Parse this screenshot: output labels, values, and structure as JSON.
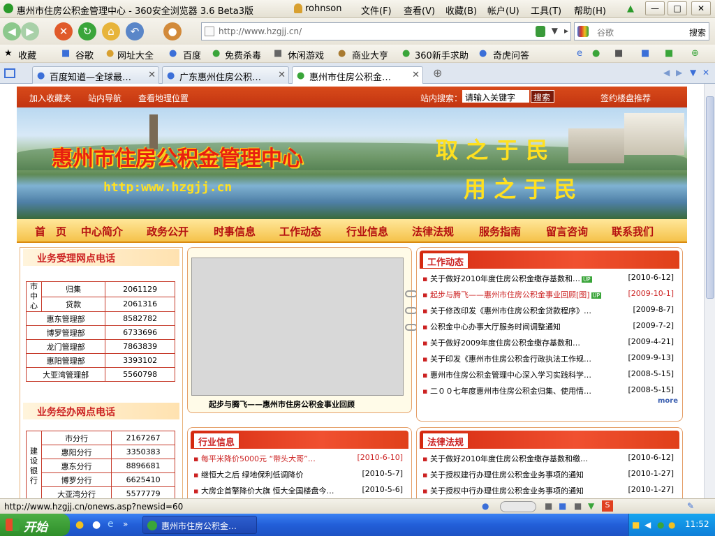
{
  "window": {
    "title": "惠州市住房公积金管理中心 - 360安全浏览器 3.6 Beta3版",
    "user": "rohnson",
    "menus": [
      "文件(F)",
      "查看(V)",
      "收藏(B)",
      "帐户(U)",
      "工具(T)",
      "帮助(H)"
    ]
  },
  "nav": {
    "url": "http://www.hzgjj.cn/",
    "search_placeholder": "谷歌",
    "search_button": "搜索"
  },
  "favorites": {
    "label": "收藏",
    "items": [
      "谷歌",
      "网址大全",
      "百度",
      "免费杀毒",
      "休闲游戏",
      "商业大亨",
      "360新手求助",
      "奇虎问答"
    ]
  },
  "tabs": [
    {
      "label": "百度知道—全球最…"
    },
    {
      "label": "广东惠州住房公积…"
    },
    {
      "label": "惠州市住房公积金…"
    }
  ],
  "site": {
    "toplinks": [
      "加入收藏夹",
      "站内导航",
      "查看地理位置"
    ],
    "search_label": "站内搜索：",
    "search_placeholder": "请输入关键字",
    "search_button": "搜索",
    "top_right": "签约楼盘推荐",
    "banner_title": "惠州市住房公积金管理中心",
    "banner_url": "http:www.hzgjj.cn",
    "slogan1": "取 之 于 民",
    "slogan2": "用 之 于 民",
    "menu": [
      "首　页",
      "中心简介",
      "政务公开",
      "时事信息",
      "工作动态",
      "行业信息",
      "法律法规",
      "服务指南",
      "留言咨询",
      "联系我们"
    ],
    "phones_title": "业务受理网点电话",
    "phones_group": "市中心",
    "phones": [
      {
        "name": "归集",
        "num": "2061129"
      },
      {
        "name": "贷款",
        "num": "2061316"
      },
      {
        "name": "惠东管理部",
        "num": "8582782"
      },
      {
        "name": "博罗管理部",
        "num": "6733696"
      },
      {
        "name": "龙门管理部",
        "num": "7863839"
      },
      {
        "name": "惠阳管理部",
        "num": "3393102"
      },
      {
        "name": "大亚湾管理部",
        "num": "5560798"
      }
    ],
    "banks_title": "业务经办网点电话",
    "banks_group": "建设银行",
    "banks": [
      {
        "name": "市分行",
        "num": "2167267"
      },
      {
        "name": "惠阳分行",
        "num": "3350383"
      },
      {
        "name": "惠东分行",
        "num": "8896681"
      },
      {
        "name": "博罗分行",
        "num": "6625410"
      },
      {
        "name": "大亚湾分行",
        "num": "5577779"
      }
    ],
    "slide_caption": "起步与腾飞——惠州市住房公积金事业回顾",
    "work_title": "工作动态",
    "work": [
      {
        "t": "关于做好2010年度住房公积金缴存基数和…",
        "d": "[2010-6-12]",
        "badge": "UP"
      },
      {
        "t": "起步与腾飞——惠州市住房公积金事业回顾[图]",
        "d": "[2009-10-1]",
        "badge": "UP"
      },
      {
        "t": "关于修改印发《惠州市住房公积金贷款程序》…",
        "d": "[2009-8-7]",
        "badge": ""
      },
      {
        "t": "公积金中心办事大厅服务时间调整通知",
        "d": "[2009-7-2]",
        "badge": ""
      },
      {
        "t": "关于做好2009年度住房公积金缴存基数和…",
        "d": "[2009-4-21]",
        "badge": ""
      },
      {
        "t": "关于印发《惠州市住房公积金行政执法工作规…",
        "d": "[2009-9-13]",
        "badge": ""
      },
      {
        "t": "惠州市住房公积金管理中心深入学习实践科学…",
        "d": "[2008-5-15]",
        "badge": ""
      },
      {
        "t": "二００七年度惠州市住房公积金归集、使用情…",
        "d": "[2008-5-15]",
        "badge": ""
      }
    ],
    "more": "more",
    "industry_title": "行业信息",
    "industry": [
      {
        "t": "每平米降价5000元 “带头大哥”…",
        "d": "[2010-6-10]"
      },
      {
        "t": "继恒大之后 绿地保利低调降价",
        "d": "[2010-5-7]"
      },
      {
        "t": "大房企首擎降价大旗 恒大全国楼盘今…",
        "d": "[2010-5-6]"
      }
    ],
    "law_title": "法律法规",
    "law": [
      {
        "t": "关于做好2010年度住房公积金缴存基数和缴…",
        "d": "[2010-6-12]"
      },
      {
        "t": "关于授权建行办理住房公积金业务事项的通知",
        "d": "[2010-1-27]"
      },
      {
        "t": "关于授权中行办理住房公积金业务事项的通知",
        "d": "[2010-1-27]"
      }
    ]
  },
  "status": {
    "url": "http://www.hzgjj.cn/onews.asp?newsid=60"
  },
  "taskbar": {
    "start": "开始",
    "task": "惠州市住房公积金…",
    "clock": "11:52"
  }
}
